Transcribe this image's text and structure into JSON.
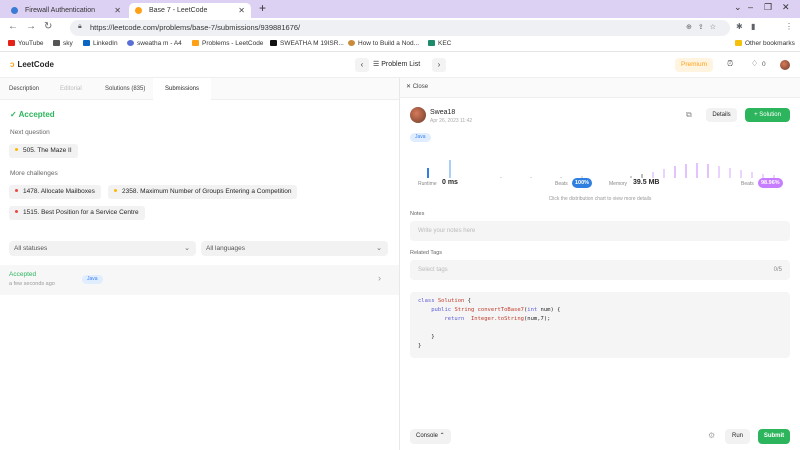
{
  "browser": {
    "tabs": [
      {
        "title": "Firewall Authentication Keepalive"
      },
      {
        "title": "Base 7 - LeetCode"
      }
    ],
    "new_tab": "+",
    "url": "https://leetcode.com/problems/base-7/submissions/939881676/",
    "bookmarks": [
      "YouTube",
      "sky",
      "LinkedIn",
      "sweatha m - A4",
      "Problems - LeetCode",
      "SWEATHA M 19ISR...",
      "How to Build a Nod...",
      "KEC"
    ],
    "other_bookmarks": "Other bookmarks"
  },
  "lc_header": {
    "logo": "LeetCode",
    "problem_list": "Problem List",
    "premium": "Premium",
    "streak": "0"
  },
  "left": {
    "tabs": [
      "Description",
      "Editorial",
      "Solutions (835)",
      "Submissions"
    ],
    "status": "Accepted",
    "next_question_label": "Next question",
    "next_question": "505. The Maze II",
    "more_challenges_label": "More challenges",
    "challenges": [
      {
        "title": "1478. Allocate Mailboxes",
        "color": "#ef4743"
      },
      {
        "title": "2358. Maximum Number of Groups Entering a Competition",
        "color": "#ffb800"
      },
      {
        "title": "1515. Best Position for a Service Centre",
        "color": "#ef4743"
      }
    ],
    "filter_status": "All statuses",
    "filter_language": "All languages",
    "submission": {
      "status": "Accepted",
      "time": "a few seconds ago",
      "language": "Java"
    }
  },
  "right": {
    "close": "Close",
    "user": "Swea18",
    "date": "Apr 26, 2023 11:42",
    "details": "Details",
    "solution": "+ Solution",
    "language": "Java",
    "runtime_label": "Runtime",
    "runtime_value": "0 ms",
    "runtime_beats_label": "Beats",
    "runtime_beats": "100%",
    "memory_label": "Memory",
    "memory_value": "39.5 MB",
    "memory_beats_label": "Beats",
    "memory_beats": "98.96%",
    "hint": "Click the distribution chart to view more details",
    "notes_label": "Notes",
    "notes_placeholder": "Write your notes here",
    "tags_label": "Related Tags",
    "tags_placeholder": "Select tags",
    "tags_count": "0/5",
    "console": "Console",
    "run": "Run",
    "submit": "Submit"
  },
  "colors": {
    "accent_green": "#2db55d",
    "brand_orange": "#ffa116",
    "runtime_blue": "#2f7fe0",
    "memory_purple": "#c77dff"
  }
}
